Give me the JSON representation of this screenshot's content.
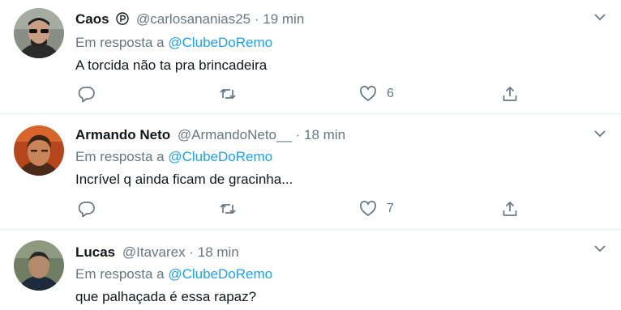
{
  "tweets": [
    {
      "name": "Caos",
      "badge_icon": "parler-p-icon",
      "handle": "@carlosananias25",
      "time": "19 min",
      "reply_prefix": "Em resposta a",
      "reply_to": "@ClubeDoRemo",
      "text": "A torcida não ta pra brincadeira",
      "likes": "6",
      "avatar_colors": {
        "bg": "#8a8f86",
        "face": "#c89f84",
        "hair": "#1d1d1d"
      }
    },
    {
      "name": "Armando Neto",
      "handle": "@ArmandoNeto__",
      "time": "18 min",
      "reply_prefix": "Em resposta a",
      "reply_to": "@ClubeDoRemo",
      "text": "Incrível q ainda ficam de gracinha...",
      "likes": "7",
      "avatar_colors": {
        "bg": "#b5461b",
        "face": "#c9855a",
        "hair": "#3a2414"
      }
    },
    {
      "name": "Lucas",
      "handle": "@Itavarex",
      "time": "18 min",
      "reply_prefix": "Em resposta a",
      "reply_to": "@ClubeDoRemo",
      "text": "que palhaçada é essa rapaz?",
      "avatar_colors": {
        "bg": "#6f7d63",
        "face": "#b38a6c",
        "hair": "#2a2623"
      }
    }
  ],
  "colors": {
    "accent": "#1da1f2",
    "muted": "#657786",
    "text": "#14171a",
    "divider": "#e6ecf0"
  }
}
